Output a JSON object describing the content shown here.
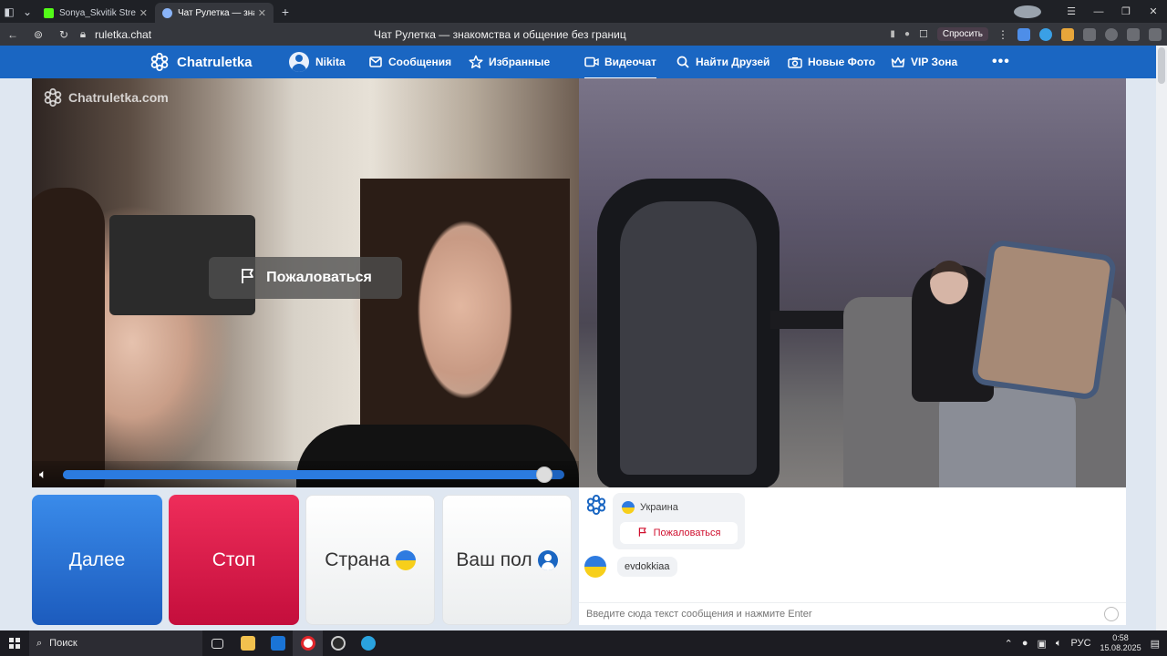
{
  "browser": {
    "tabs": [
      {
        "title": "Sonya_Skvitik Stream - Ki",
        "active": false,
        "favicon_color": "#53fc18"
      },
      {
        "title": "Чат Рулетка — знакомства и общение без границ",
        "active": true,
        "favicon_color": "#8ab4f8"
      }
    ],
    "url": "ruletka.chat",
    "page_title": "Чат Рулетка — знакомства и общение без границ",
    "ask_button": "Спросить"
  },
  "site": {
    "logo_text": "Chatruletka",
    "brand_color": "#1a66c2",
    "nav": [
      {
        "label": "Nikita",
        "icon": "user-avatar-icon"
      },
      {
        "label": "Сообщения",
        "icon": "envelope-icon"
      },
      {
        "label": "Избранные",
        "icon": "star-icon"
      },
      {
        "label": "Видеочат",
        "icon": "video-camera-icon",
        "active": true
      },
      {
        "label": "Найти Друзей",
        "icon": "search-icon"
      },
      {
        "label": "Новые Фото",
        "icon": "camera-icon"
      },
      {
        "label": "VIP Зона",
        "icon": "crown-icon"
      }
    ],
    "more_label": "•••"
  },
  "video": {
    "watermark": "Chatruletka.com",
    "report_overlay": "Пожаловаться",
    "volume_fraction": 0.96
  },
  "controls": {
    "next": "Далее",
    "stop": "Стоп",
    "country": "Страна",
    "gender": "Ваш пол",
    "next_color": "#1c5bbd",
    "stop_color": "#c40e3c"
  },
  "chat": {
    "system_country": "Украина",
    "system_report": "Пожаловаться",
    "partner_nick": "evdokkiaa",
    "input_placeholder": "Введите сюда текст сообщения и нажмите Enter"
  },
  "taskbar": {
    "search_label": "Поиск",
    "language": "РУС",
    "time": "0:58",
    "date": "15.08.2025"
  }
}
